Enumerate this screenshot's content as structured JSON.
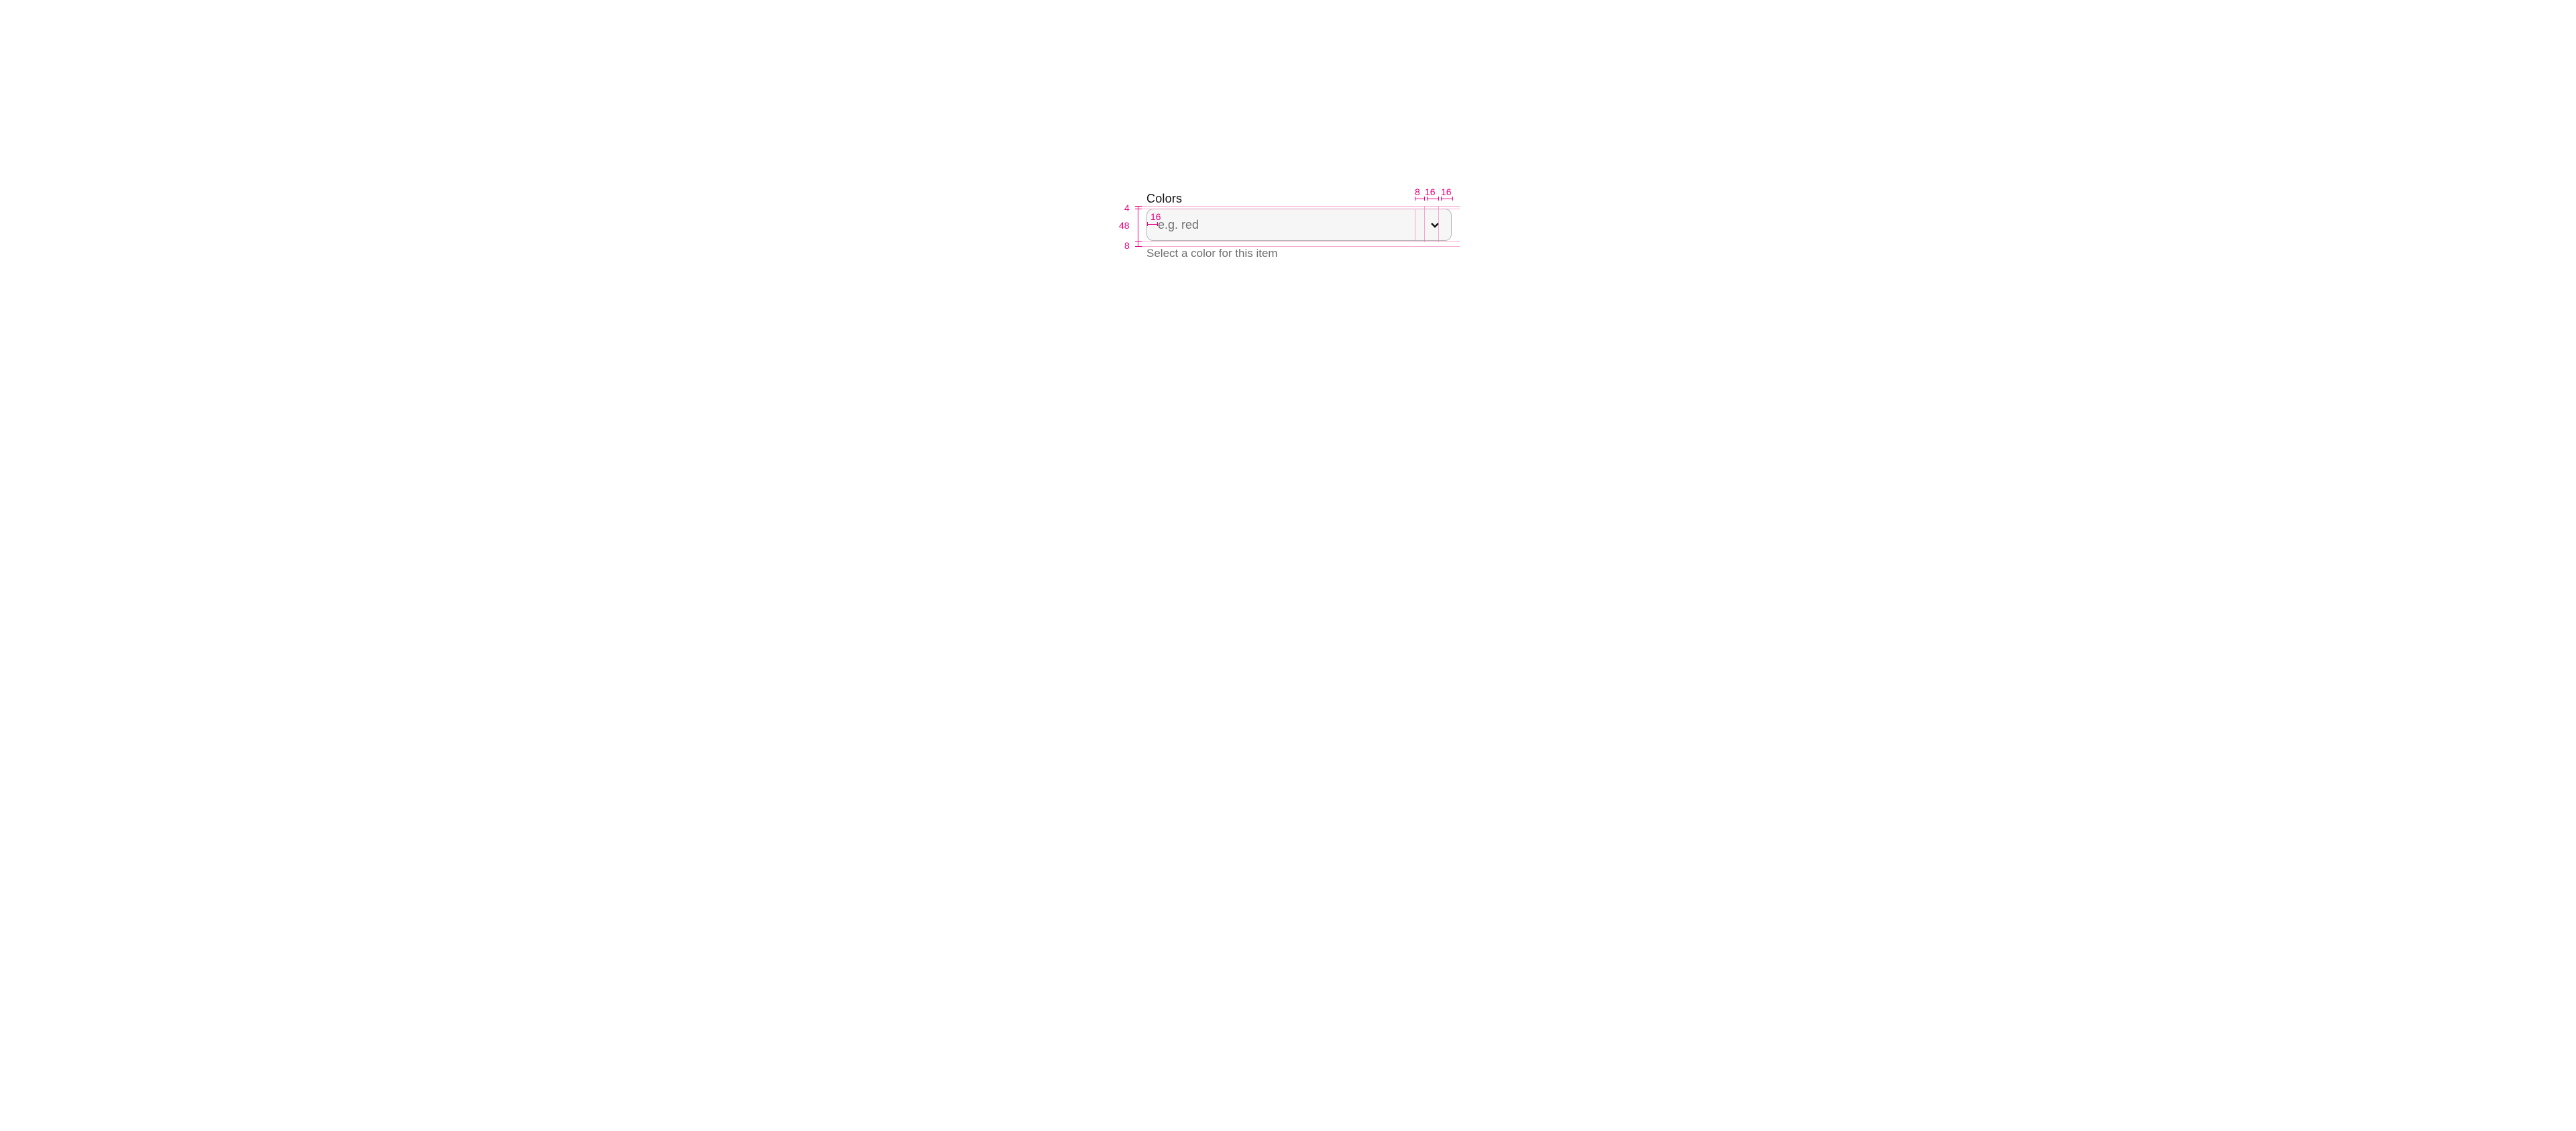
{
  "field": {
    "label": "Colors",
    "placeholder": "e.g. red",
    "helper": "Select a color for this item"
  },
  "spec": {
    "label_to_input_gap": "4",
    "input_height": "48",
    "input_to_helper_gap": "8",
    "input_left_padding": "16",
    "right_padding_after_icon": "16",
    "icon_width": "16",
    "gap_before_icon": "8"
  }
}
